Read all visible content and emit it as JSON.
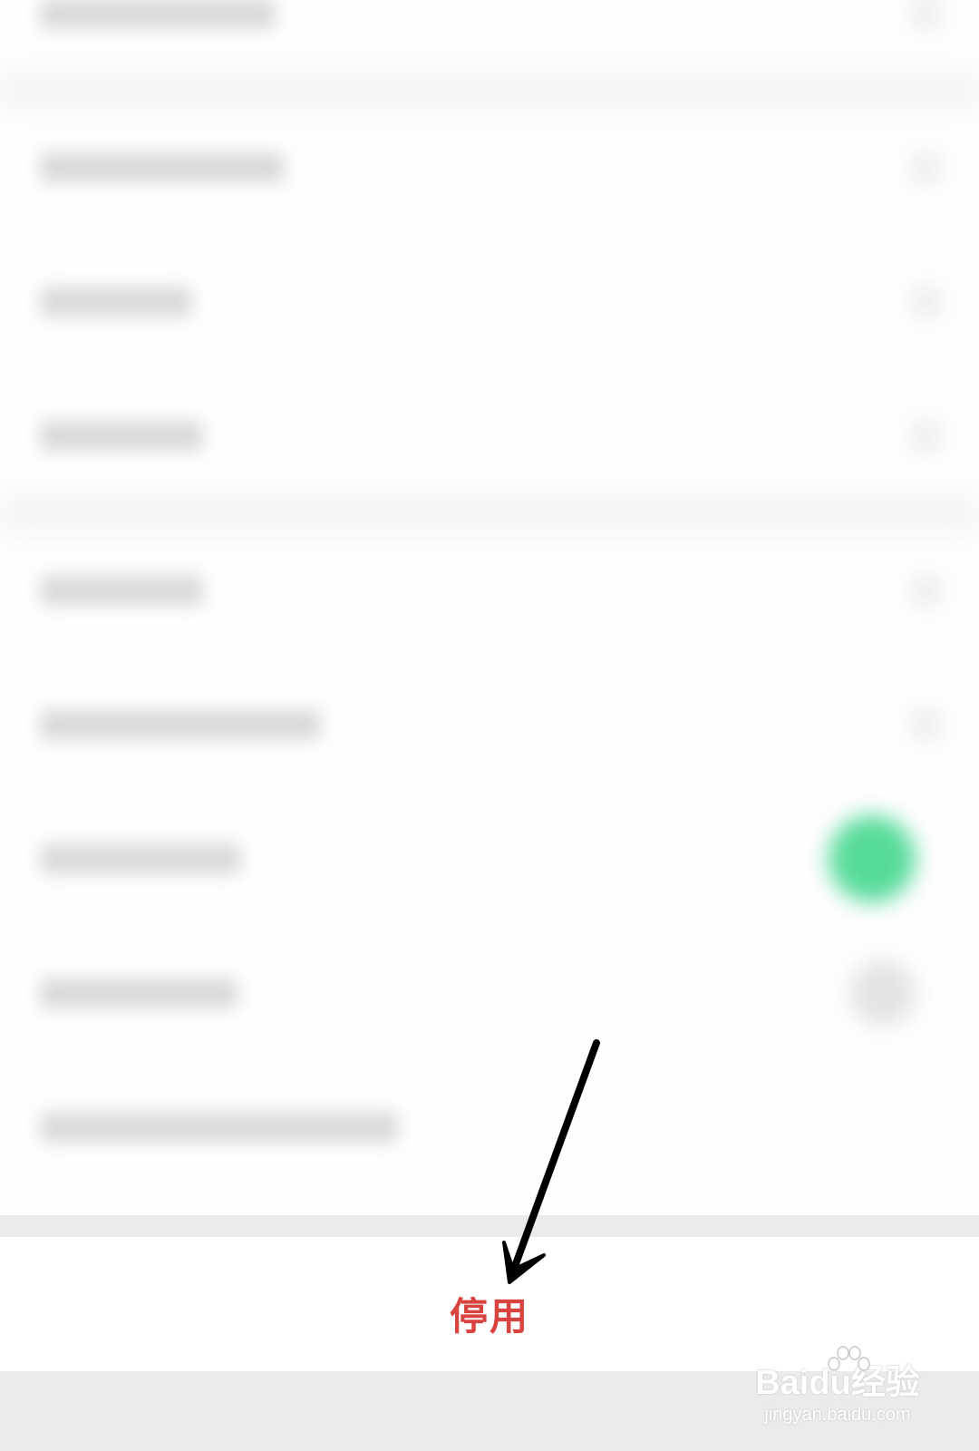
{
  "settings": {
    "toggle_states": {
      "row_7": "on",
      "row_8": "off"
    }
  },
  "disable_bar": {
    "label": "停用",
    "label_color": "#d9433f"
  },
  "annotation": {
    "arrow_color": "#000000",
    "points_to": "disable-button"
  },
  "watermark": {
    "brand": "Baidu经验",
    "url": "jingyan.baidu.com"
  },
  "colors": {
    "toggle_on": "#45d88e",
    "background": "#fefefe",
    "separator": "#ebebeb"
  }
}
